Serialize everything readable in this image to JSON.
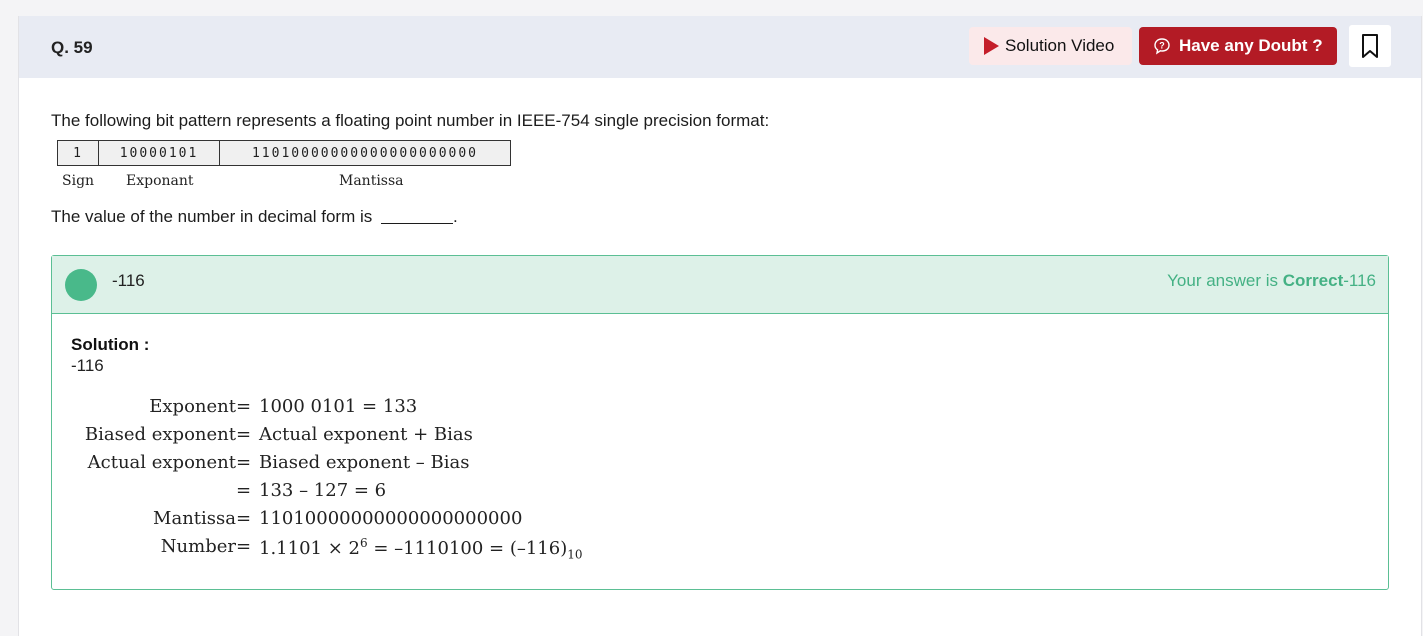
{
  "header": {
    "question_number": "Q. 59",
    "solution_video_label": "Solution Video",
    "doubt_label": "Have any Doubt ?"
  },
  "question": {
    "text": "The following bit pattern represents a floating point number in IEEE-754 single precision format:",
    "bits": {
      "sign": "1",
      "exponent": "10000101",
      "mantissa": "11010000000000000000000"
    },
    "labels": {
      "sign": "Sign",
      "exponent": "Exponant",
      "mantissa": "Mantissa"
    },
    "prompt": "The value of the number in decimal form is",
    "prompt_end": "."
  },
  "answer": {
    "value": "-116",
    "result_prefix": "Your answer is ",
    "result_status": "Correct",
    "result_value": "-116"
  },
  "solution": {
    "title": "Solution :",
    "value": "-116",
    "rows": [
      {
        "lhs": "Exponent",
        "eq": "=",
        "rhs": "1000 0101 = 133"
      },
      {
        "lhs": "Biased exponent",
        "eq": "=",
        "rhs": "Actual exponent + Bias"
      },
      {
        "lhs": "Actual exponent",
        "eq": "=",
        "rhs": "Biased exponent – Bias"
      },
      {
        "lhs": "",
        "eq": "=",
        "rhs": "133 – 127 = 6"
      },
      {
        "lhs": "Mantissa",
        "eq": "=",
        "rhs": "11010000000000000000000"
      }
    ],
    "number_row": {
      "lhs": "Number",
      "eq": "=",
      "rhs_a": "1.1101 × 2",
      "exp": "6",
      "rhs_b": " = –1110100 = (–116)",
      "sub": "10"
    }
  },
  "colors": {
    "brand_red": "#b31b25",
    "correct_green": "#44b184",
    "header_bg": "#e8ebf3"
  },
  "icons": [
    "play-icon",
    "doubt-icon",
    "bookmark-icon"
  ]
}
